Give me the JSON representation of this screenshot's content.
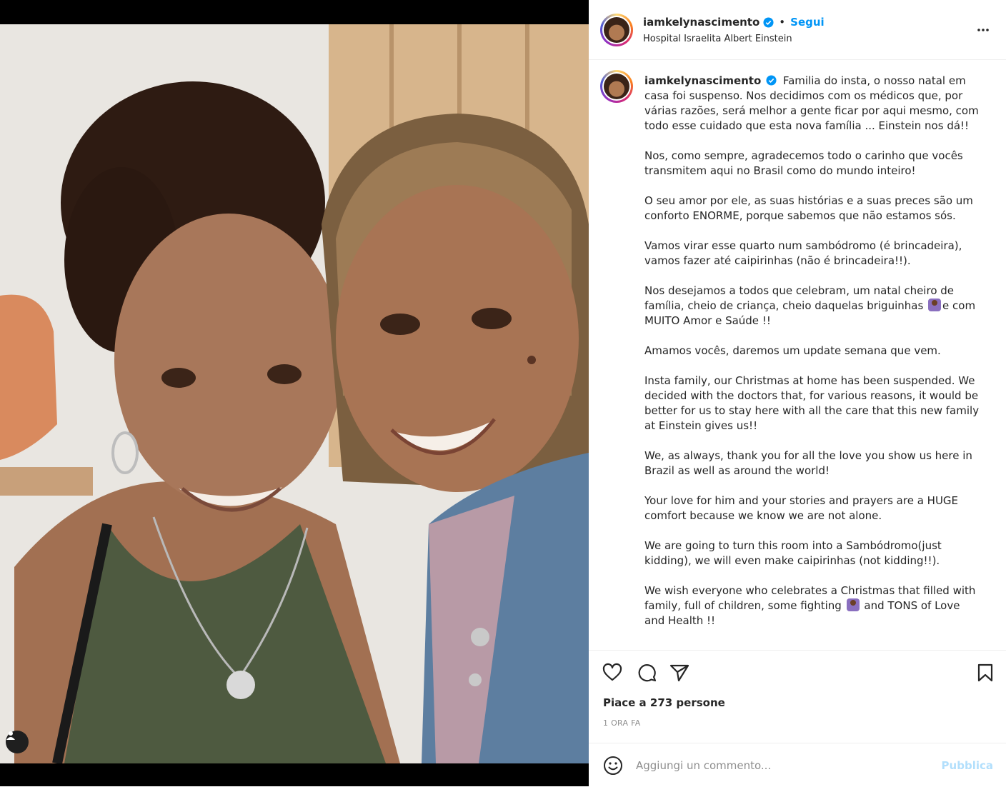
{
  "header": {
    "username": "iamkelynascimento",
    "separator": "•",
    "follow_label": "Segui",
    "location": "Hospital Israelita Albert Einstein",
    "more_icon": "more-horizontal-icon"
  },
  "caption": {
    "username": "iamkelynascimento",
    "paragraphs": {
      "p1": "Familia do insta, o nosso natal em casa foi suspenso. Nos decidimos com os médicos que, por várias razões, será melhor a gente ficar por aqui mesmo, com todo esse cuidado que esta nova família ... Einstein nos dá!!",
      "p2": "Nos, como sempre, agradecemos todo o carinho que vocês transmitem aqui no Brasil como do mundo inteiro!",
      "p3": "O seu amor por ele, as suas histórias e a suas preces são um conforto ENORME, porque sabemos que não estamos sós.",
      "p4": "Vamos virar esse quarto num sambódromo (é brincadeira), vamos fazer até caipirinhas (não é brincadeira!!).",
      "p5a": "Nos desejamos a todos que celebram, um natal cheiro de família, cheio de criança, cheio daquelas briguinhas",
      "p5b": "e com MUITO Amor e Saúde !!",
      "p6": "Amamos vocês, daremos um update semana que vem.",
      "p7": "Insta family, our Christmas at home has been suspended. We decided with the doctors that, for various reasons, it would be better for us to stay here with all the care that this new family at Einstein gives us!!",
      "p8": "We, as always, thank you for all the love you show us here in Brazil as well as around the world!",
      "p9": "Your love for him and your stories and prayers are a HUGE comfort because we know we are not alone.",
      "p10": "We are going to turn this room into a Sambódromo(just kidding), we will even make caipirinhas (not kidding!!).",
      "p11a": "We wish everyone who celebrates a Christmas that filled with family, full of children, some fighting",
      "p11b": "and TONS of Love and Health !!"
    }
  },
  "actions": {
    "like_icon": "heart-icon",
    "comment_icon": "comment-icon",
    "share_icon": "send-icon",
    "save_icon": "bookmark-icon"
  },
  "likes_text": "Piace a 273 persone",
  "timestamp": "1 ORA FA",
  "comment": {
    "placeholder": "Aggiungi un commento...",
    "publish_label": "Pubblica"
  },
  "colors": {
    "accent_blue": "#0095f6",
    "publish_disabled": "#b2dffc",
    "muted_text": "#8e8e8e"
  }
}
